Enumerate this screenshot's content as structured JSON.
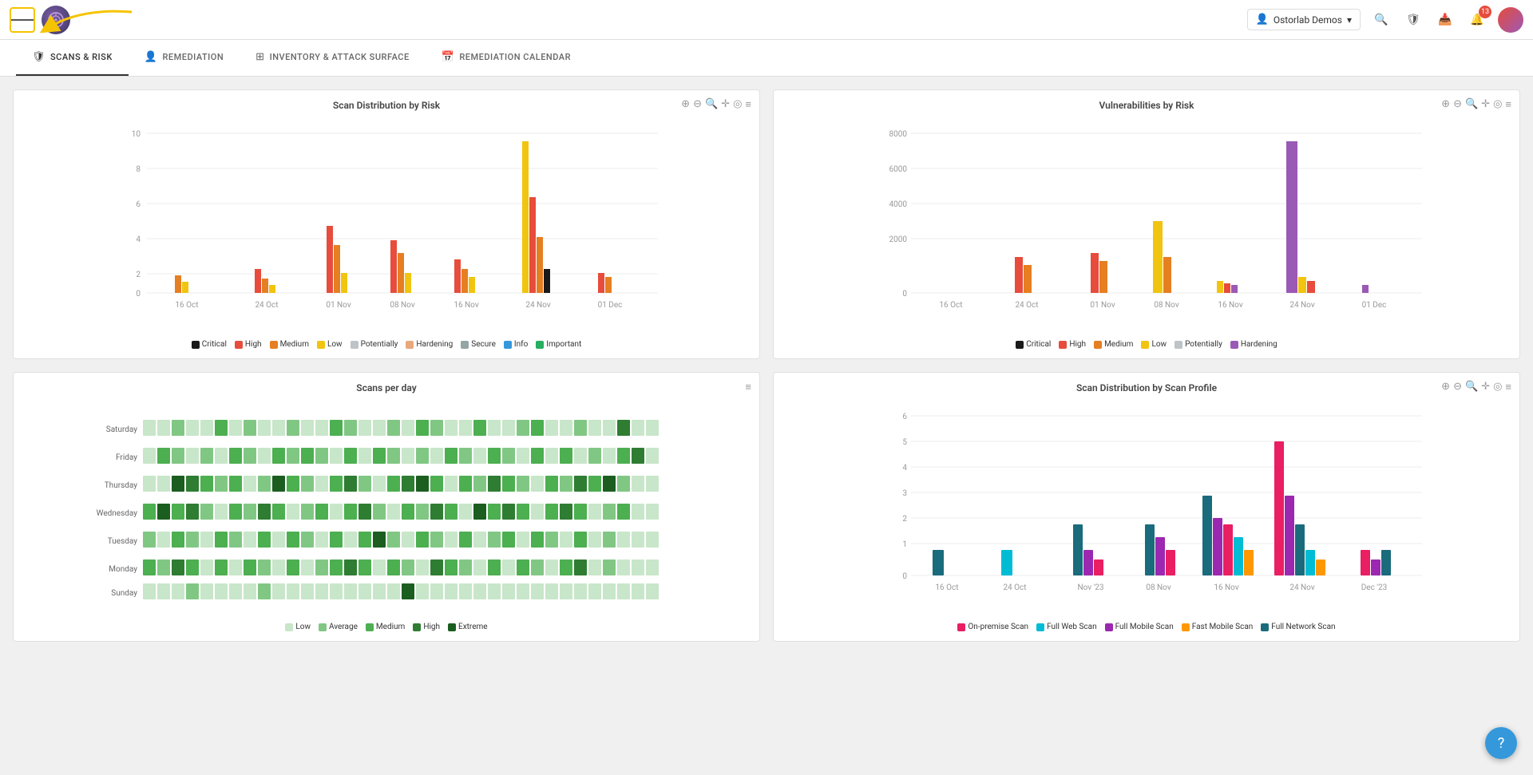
{
  "app": {
    "user": "Ostorlab Demos",
    "notification_count": "13"
  },
  "tabs": [
    {
      "id": "scans-risk",
      "label": "SCANS & RISK",
      "icon": "shield",
      "active": true
    },
    {
      "id": "remediation",
      "label": "REMEDIATION",
      "icon": "person",
      "active": false
    },
    {
      "id": "inventory",
      "label": "INVENTORY & ATTACK SURFACE",
      "icon": "grid",
      "active": false
    },
    {
      "id": "remediation-calendar",
      "label": "REMEDIATION CALENDAR",
      "icon": "calendar",
      "active": false
    }
  ],
  "charts": {
    "scan_distribution_risk": {
      "title": "Scan Distribution by Risk",
      "x_labels": [
        "16 Oct",
        "24 Oct",
        "01 Nov",
        "08 Nov",
        "16 Nov",
        "24 Nov",
        "01 Dec"
      ],
      "y_labels": [
        "0",
        "2",
        "4",
        "6",
        "8",
        "10"
      ],
      "legend": [
        {
          "label": "Critical",
          "color": "#1a1a1a"
        },
        {
          "label": "High",
          "color": "#e74c3c"
        },
        {
          "label": "Medium",
          "color": "#e67e22"
        },
        {
          "label": "Low",
          "color": "#f1c40f"
        },
        {
          "label": "Potentially",
          "color": "#bdc3c7"
        },
        {
          "label": "Hardening",
          "color": "#e8a87c"
        },
        {
          "label": "Secure",
          "color": "#95a5a6"
        },
        {
          "label": "Info",
          "color": "#3498db"
        },
        {
          "label": "Important",
          "color": "#27ae60"
        }
      ]
    },
    "vulnerabilities_risk": {
      "title": "Vulnerabilities by Risk",
      "x_labels": [
        "16 Oct",
        "24 Oct",
        "01 Nov",
        "08 Nov",
        "16 Nov",
        "24 Nov",
        "01 Dec"
      ],
      "y_labels": [
        "0",
        "2000",
        "4000",
        "6000",
        "8000"
      ],
      "legend": [
        {
          "label": "Critical",
          "color": "#1a1a1a"
        },
        {
          "label": "High",
          "color": "#e74c3c"
        },
        {
          "label": "Medium",
          "color": "#e67e22"
        },
        {
          "label": "Low",
          "color": "#f1c40f"
        },
        {
          "label": "Potentially",
          "color": "#bdc3c7"
        },
        {
          "label": "Hardening",
          "color": "#9b59b6"
        }
      ]
    },
    "scans_per_day": {
      "title": "Scans per day",
      "y_labels": [
        "Saturday",
        "Friday",
        "Thursday",
        "Wednesday",
        "Tuesday",
        "Monday",
        "Sunday"
      ],
      "legend": [
        {
          "label": "Low",
          "color": "#c8e6c9"
        },
        {
          "label": "Average",
          "color": "#81c784"
        },
        {
          "label": "Medium",
          "color": "#4caf50"
        },
        {
          "label": "High",
          "color": "#2e7d32"
        },
        {
          "label": "Extreme",
          "color": "#1b5e20"
        }
      ]
    },
    "scan_distribution_profile": {
      "title": "Scan Distribution by Scan Profile",
      "x_labels": [
        "16 Oct",
        "24 Oct",
        "Nov '23",
        "08 Nov",
        "16 Nov",
        "24 Nov",
        "Dec '23"
      ],
      "y_labels": [
        "0",
        "1",
        "2",
        "3",
        "4",
        "5",
        "6"
      ],
      "legend": [
        {
          "label": "On-premise Scan",
          "color": "#e91e63"
        },
        {
          "label": "Full Web Scan",
          "color": "#00bcd4"
        },
        {
          "label": "Full Mobile Scan",
          "color": "#9c27b0"
        },
        {
          "label": "Fast Mobile Scan",
          "color": "#ff9800"
        },
        {
          "label": "Full Network Scan",
          "color": "#1a6b7c"
        }
      ]
    }
  },
  "help_button": "?",
  "menu_lines": [
    "",
    "",
    ""
  ]
}
